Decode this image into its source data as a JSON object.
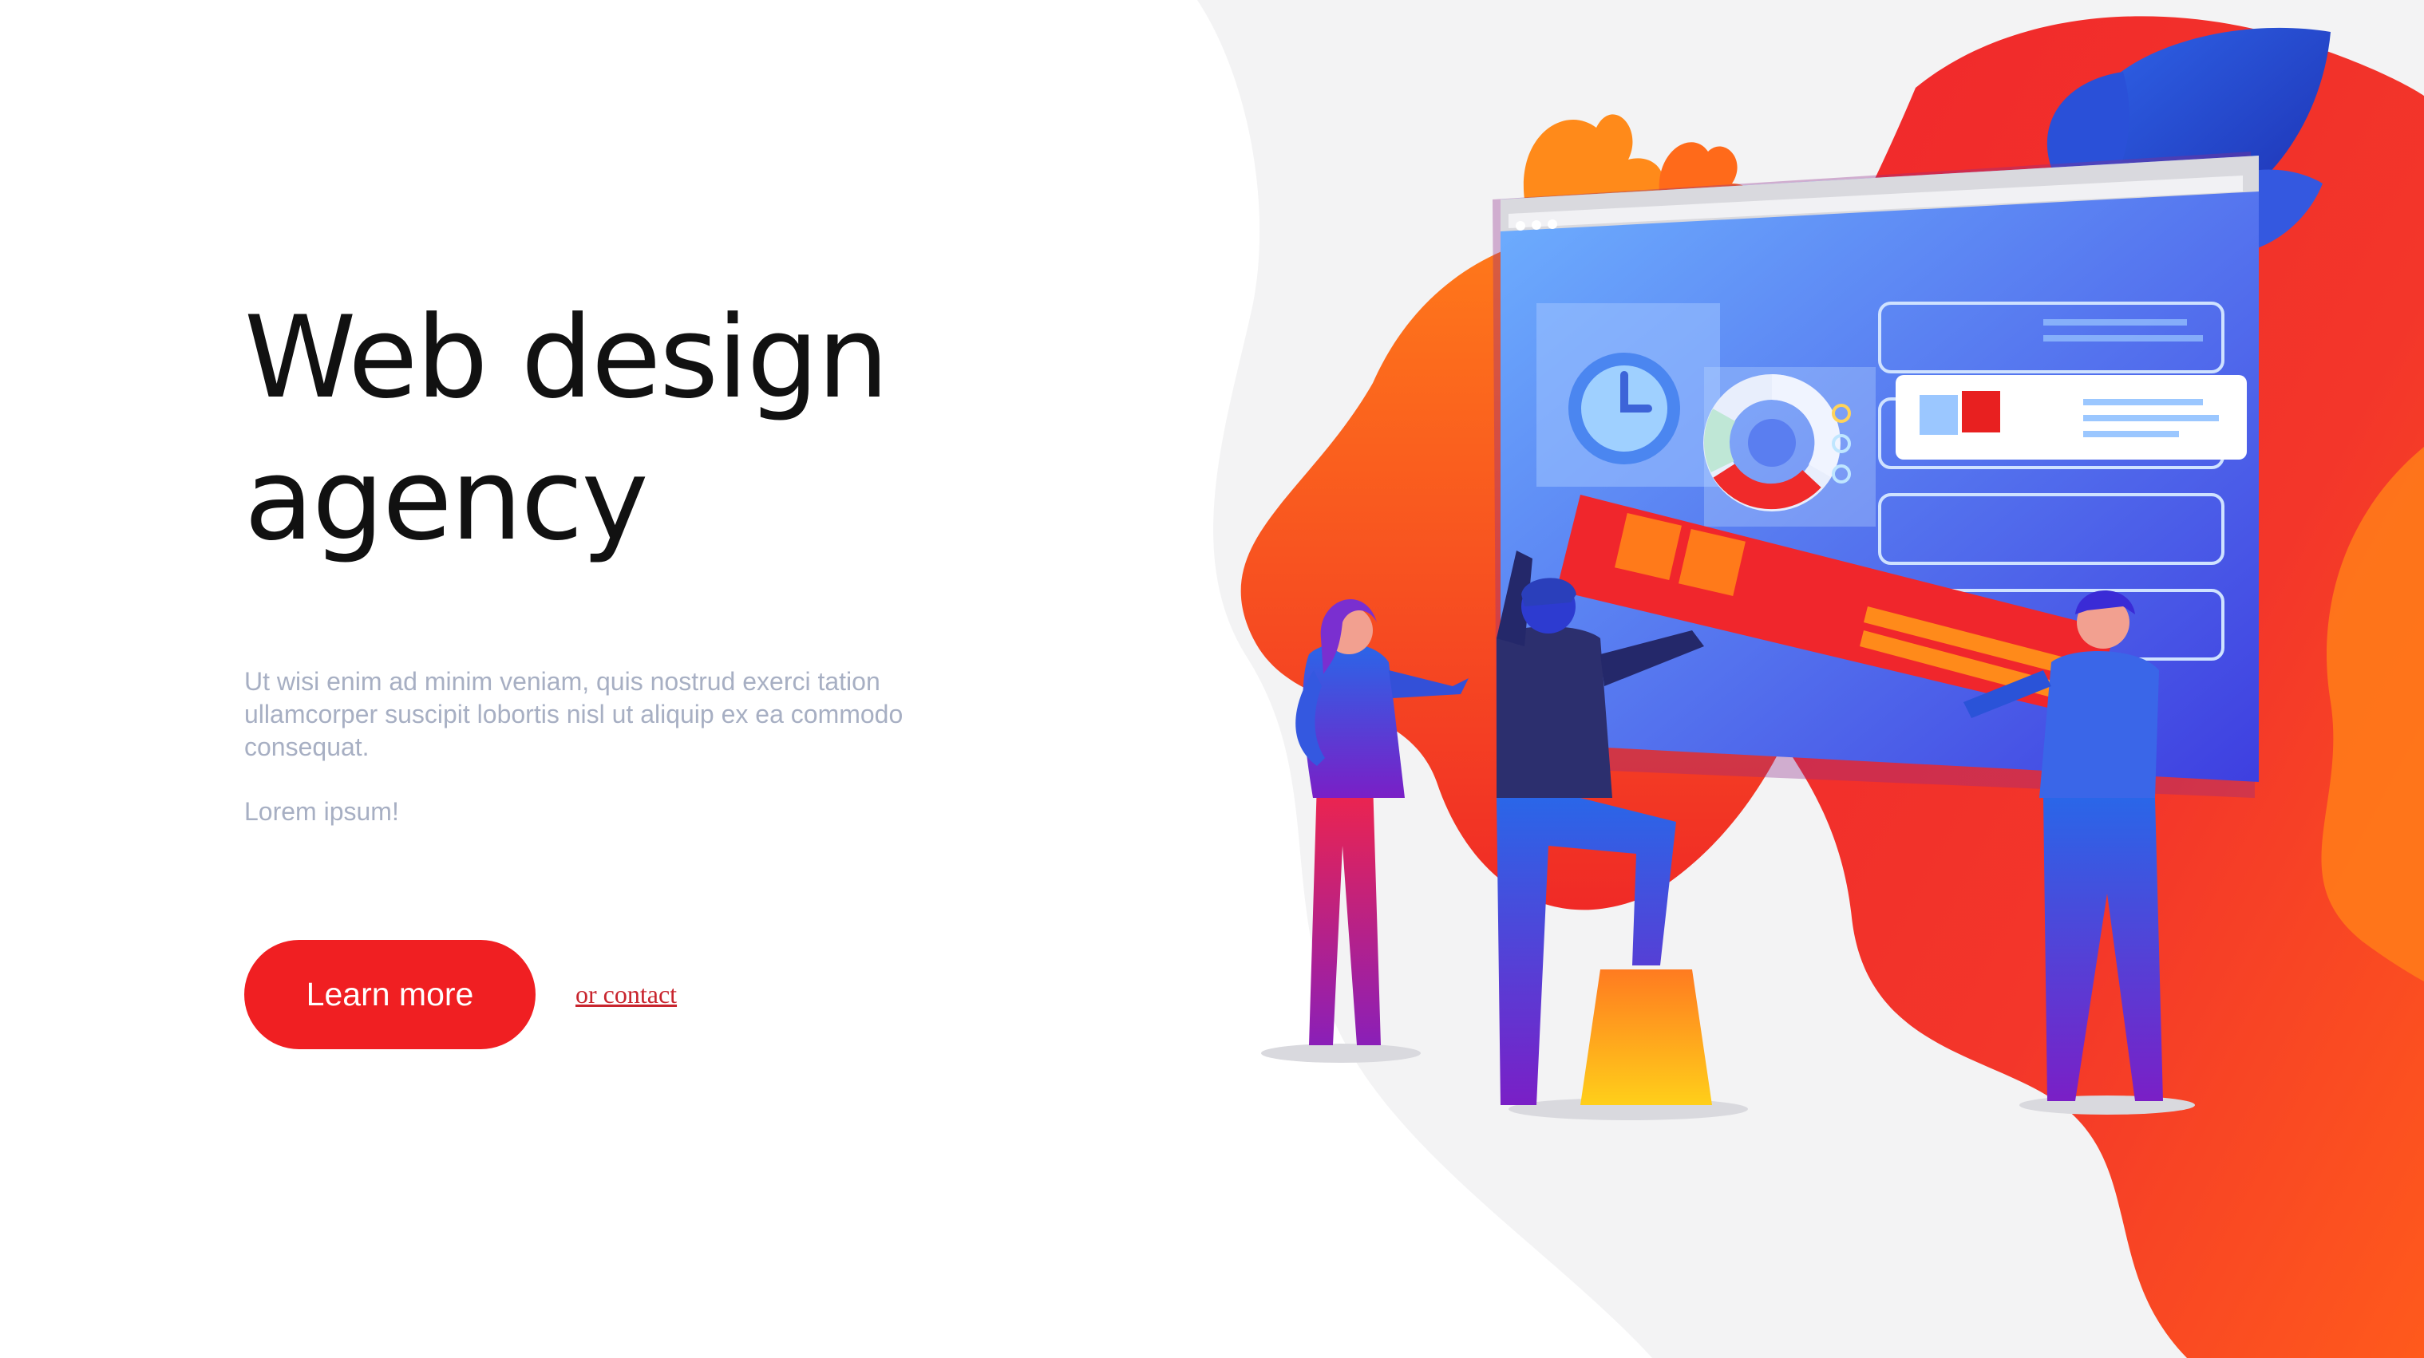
{
  "hero": {
    "headline_line1": "Web design",
    "headline_line2": "agency",
    "body_text": "Ut wisi enim ad minim veniam, quis nostrud exerci tation ullamcorper suscipit lobortis nisl ut aliquip ex ea commodo consequat.",
    "short_text": "Lorem ipsum!"
  },
  "cta": {
    "primary_label": "Learn more",
    "secondary_label": "or contact"
  },
  "illustration": {
    "subject": "team-building-website-illustration",
    "colors": {
      "accent_red": "#f01f22",
      "accent_orange": "#ff8a00",
      "screen_blue": "#5a8ff0",
      "deep_blue": "#3a2bd6",
      "purple": "#6b2fc8",
      "yellow": "#ffc21a"
    }
  }
}
